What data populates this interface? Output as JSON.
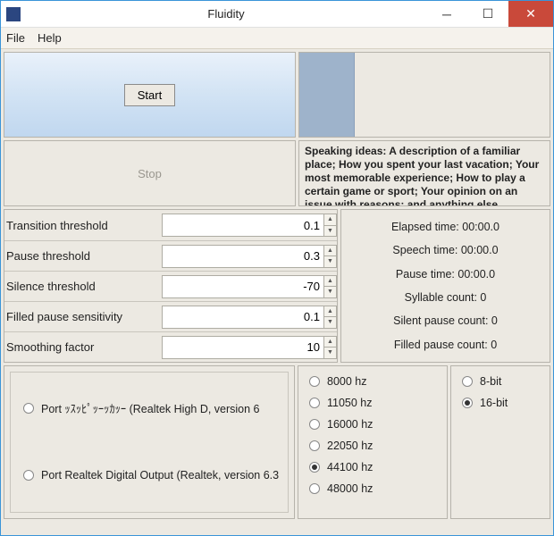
{
  "window": {
    "title": "Fluidity"
  },
  "menu": {
    "file": "File",
    "help": "Help"
  },
  "controls": {
    "start": "Start",
    "stop": "Stop"
  },
  "ideas": "Speaking ideas: A description of a familiar place; How you spent your last vacation; Your most memorable experience; How to play a certain game or sport; Your opinion on an issue with reasons; and anything else...",
  "params": {
    "transition": {
      "label": "Transition threshold",
      "value": "0.1"
    },
    "pause": {
      "label": "Pause threshold",
      "value": "0.3"
    },
    "silence": {
      "label": "Silence threshold",
      "value": "-70"
    },
    "filled": {
      "label": "Filled pause sensitivity",
      "value": "0.1"
    },
    "smoothing": {
      "label": "Smoothing factor",
      "value": "10"
    }
  },
  "stats": {
    "elapsed": "Elapsed time: 00:00.0",
    "speech": "Speech time: 00:00.0",
    "pause": "Pause time: 00:00.0",
    "syllable": "Syllable count: 0",
    "silent": "Silent pause count: 0",
    "filled": "Filled pause count: 0"
  },
  "ports": {
    "opt1": "Port ｯｽｯﾋﾟｯｰｯｶｯｰ (Realtek High D, version 6",
    "opt2": "Port Realtek Digital Output (Realtek, version 6.3"
  },
  "rates": {
    "r8000": "8000 hz",
    "r11050": "11050 hz",
    "r16000": "16000 hz",
    "r22050": "22050 hz",
    "r44100": "44100 hz",
    "r48000": "48000 hz",
    "selected": "44100"
  },
  "bits": {
    "b8": "8-bit",
    "b16": "16-bit",
    "selected": "16"
  }
}
